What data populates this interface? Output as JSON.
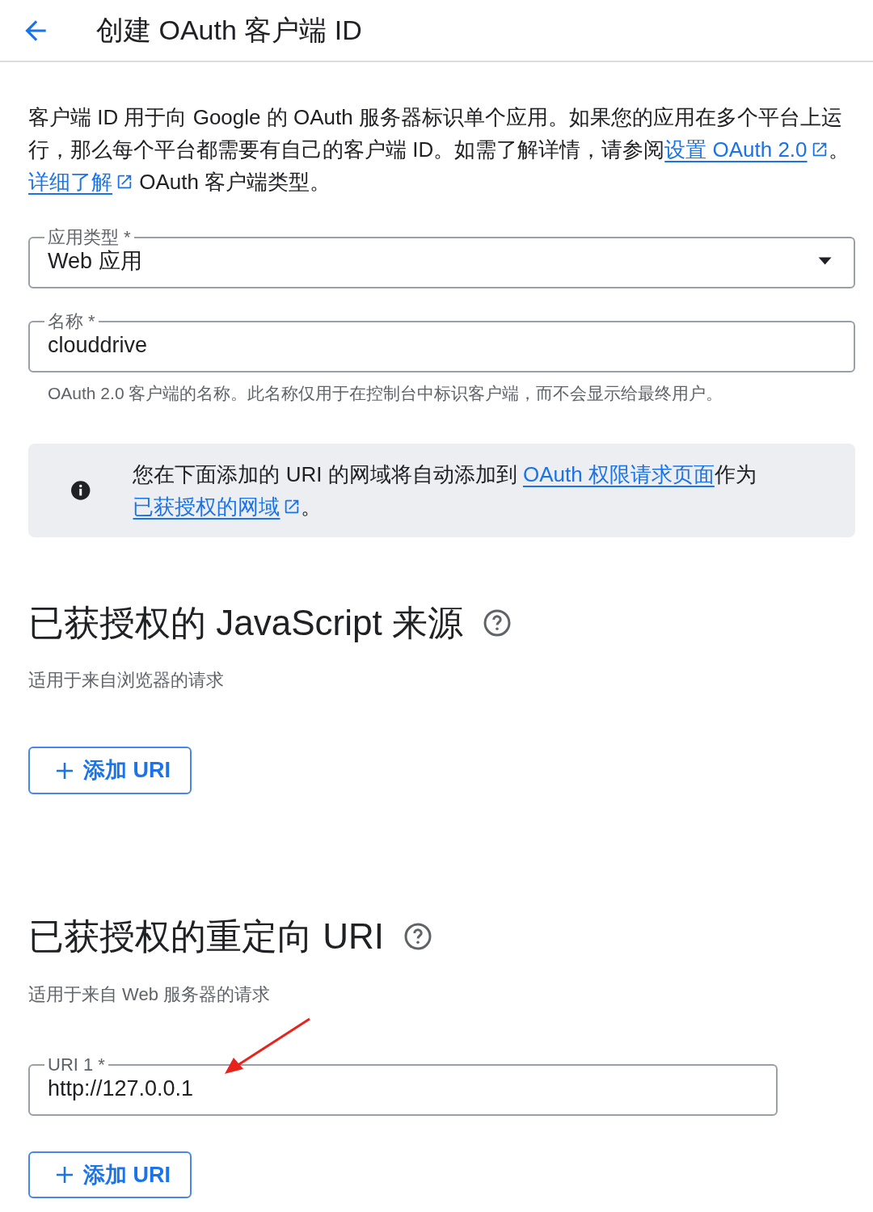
{
  "header": {
    "title": "创建 OAuth 客户端 ID"
  },
  "intro": [
    {
      "kind": "text",
      "text": "客户端 ID 用于向 Google 的 OAuth 服务器标识单个应用。如果您的应用在多个平台上运行，那么每个平台都需要有自己的客户端 ID。如需了解详情，请参阅"
    },
    {
      "kind": "link",
      "text": "设置 OAuth 2.0",
      "external": true
    },
    {
      "kind": "text",
      "text": "。 "
    },
    {
      "kind": "link",
      "text": "详细了解",
      "external": true
    },
    {
      "kind": "text",
      "text": " OAuth 客户端类型。"
    }
  ],
  "fields": [
    {
      "kind": "select",
      "label": "应用类型 *",
      "value": "Web 应用"
    },
    {
      "kind": "text",
      "label": "名称 *",
      "value": "clouddrive",
      "hint": "OAuth 2.0 客户端的名称。此名称仅用于在控制台中标识客户端，而不会显示给最终用户。"
    }
  ],
  "notice": [
    {
      "kind": "text",
      "text": "您在下面添加的 URI 的网域将自动添加到 "
    },
    {
      "kind": "link",
      "text": "OAuth 权限请求页面",
      "external": false
    },
    {
      "kind": "text",
      "text": "作为"
    },
    {
      "kind": "link",
      "text": "已获授权的网域",
      "external": true
    },
    {
      "kind": "text",
      "text": "。"
    }
  ],
  "sections": [
    {
      "title": "已获授权的 JavaScript 来源",
      "subtitle": "适用于来自浏览器的请求",
      "button": "添加 URI"
    },
    {
      "title": "已获授权的重定向 URI",
      "subtitle": "适用于来自 Web 服务器的请求",
      "uris": [
        {
          "label": "URI 1 *",
          "value": "http://127.0.0.1"
        }
      ],
      "button": "添加 URI"
    }
  ]
}
